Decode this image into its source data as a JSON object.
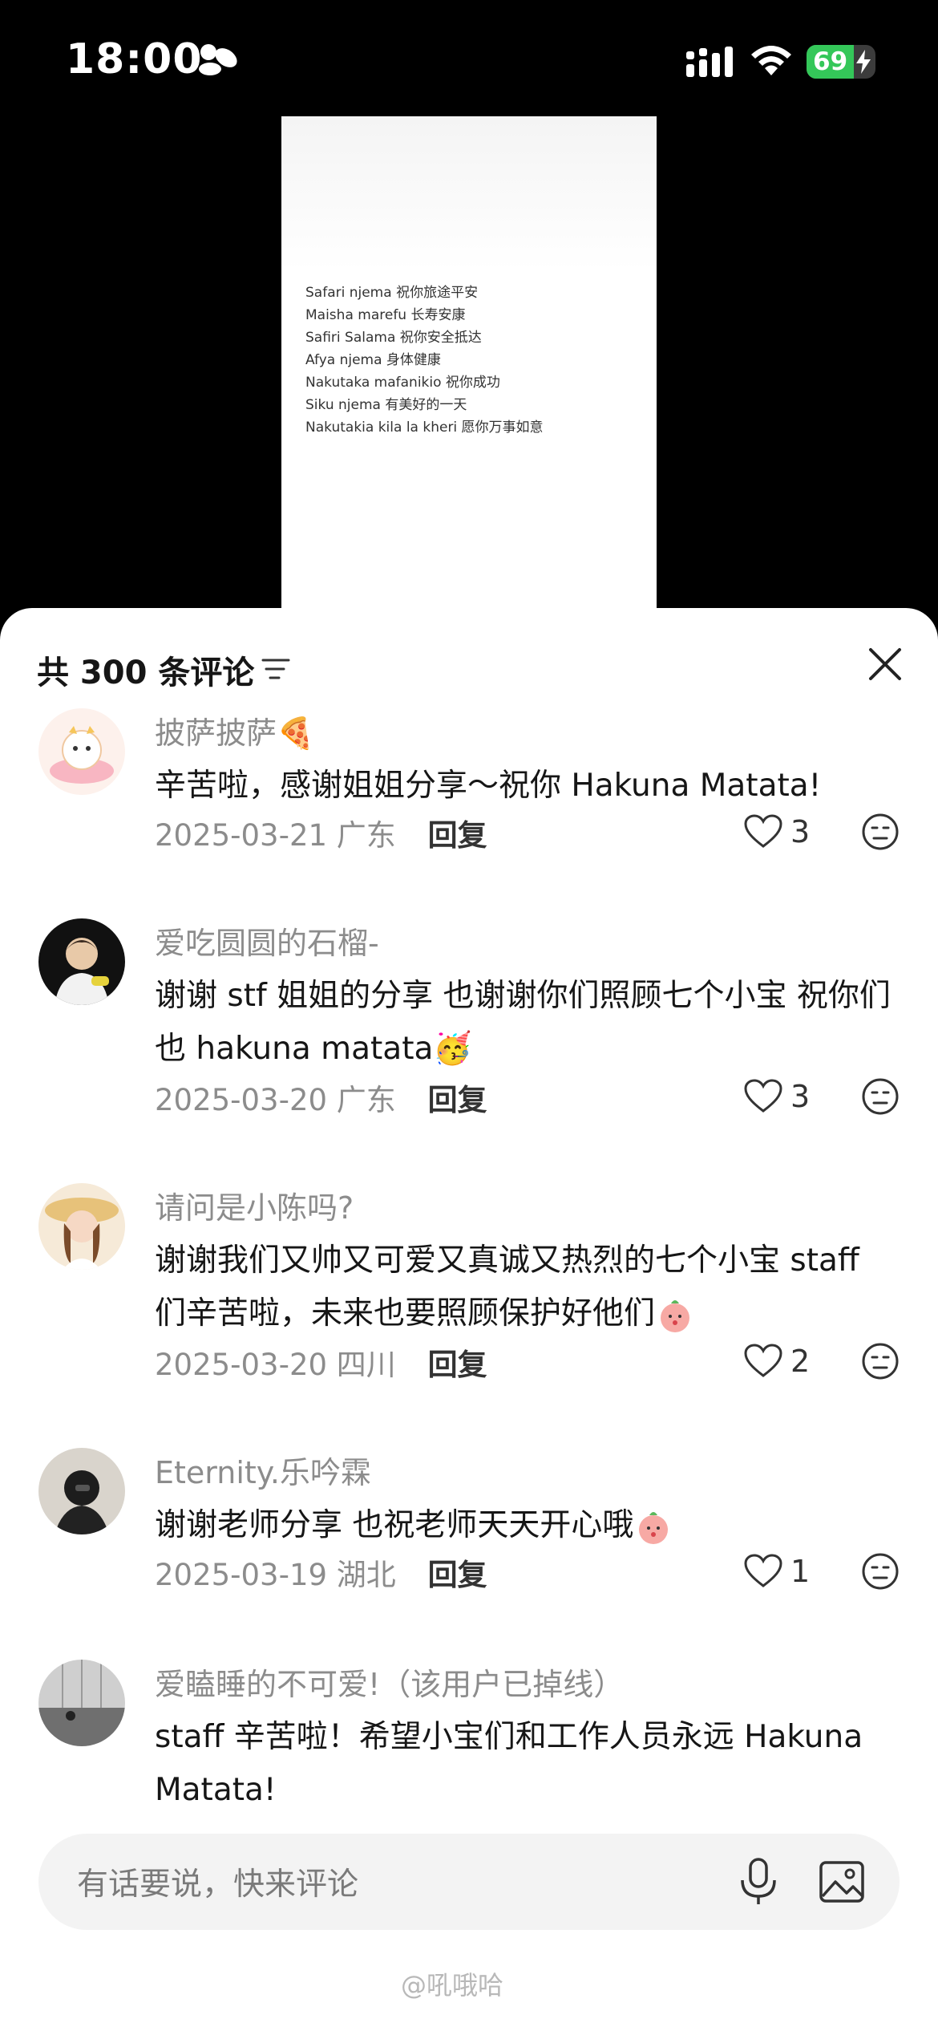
{
  "status_bar": {
    "time": "18:00",
    "battery": "69",
    "battery_level_percent": 69
  },
  "video": {
    "lines": [
      "Safari njema 祝你旅途平安",
      "Maisha marefu 长寿安康",
      "Safiri Salama 祝你安全抵达",
      "Afya njema 身体健康",
      "Nakutaka mafanikio 祝你成功",
      "Siku njema 有美好的一天",
      "Nakutakia kila la kheri 愿你万事如意"
    ]
  },
  "sheet": {
    "title": "共 300 条评论"
  },
  "comments": [
    {
      "user": "披萨披萨🍕",
      "text": "辛苦啦，感谢姐姐分享～祝你 Hakuna Matata!",
      "date": "2025-03-21",
      "location": "广东",
      "reply": "回复",
      "likes": "3"
    },
    {
      "user": "爱吃圆圆的石榴-",
      "text": "谢谢 stf 姐姐的分享 也谢谢你们照顾七个小宝 祝你们也 hakuna matata🥳",
      "date": "2025-03-20",
      "location": "广东",
      "reply": "回复",
      "likes": "3"
    },
    {
      "user": "请问是小陈吗?",
      "text": "谢谢我们又帅又可爱又真诚又热烈的七个小宝 staff 们辛苦啦，未来也要照顾保护好他们",
      "date": "2025-03-20",
      "location": "四川",
      "reply": "回复",
      "likes": "2"
    },
    {
      "user": "Eternity.乐吟霖",
      "text": "谢谢老师分享 也祝老师天天开心哦",
      "date": "2025-03-19",
      "location": "湖北",
      "reply": "回复",
      "likes": "1"
    },
    {
      "user": "爱瞌睡的不可爱!（该用户已掉线）",
      "text": "staff 辛苦啦！希望小宝们和工作人员永远 Hakuna Matata!"
    }
  ],
  "input": {
    "placeholder": "有话要说，快来评论"
  },
  "watermark": "@吼哦哈"
}
